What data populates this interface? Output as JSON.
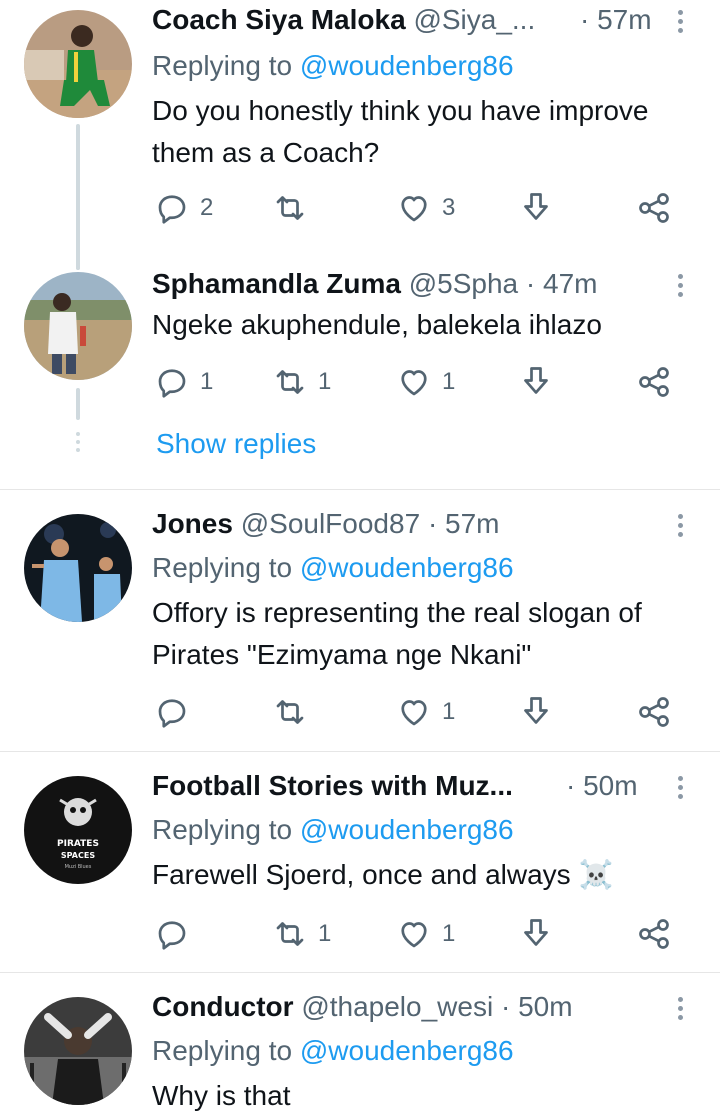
{
  "tweets": [
    {
      "name": "Coach Siya Maloka",
      "handle": "@Siya_...",
      "time": "· 57m",
      "replying_prefix": "Replying to",
      "replying_to": "@woudenberg86",
      "text": "Do you honestly think you have improve them as a Coach?",
      "replies": "2",
      "retweets": "",
      "likes": "3"
    },
    {
      "name": "Sphamandla Zuma",
      "handle": "@5Spha",
      "time": "· 47m",
      "text": "Ngeke akuphendule, balekela ihlazo",
      "replies": "1",
      "retweets": "1",
      "likes": "1",
      "show_replies": "Show replies"
    },
    {
      "name": "Jones",
      "handle": "@SoulFood87",
      "time": "· 57m",
      "replying_prefix": "Replying to",
      "replying_to": "@woudenberg86",
      "text": "Offory is representing the real slogan of Pirates \"Ezimyama nge Nkani\"",
      "replies": "",
      "retweets": "",
      "likes": "1"
    },
    {
      "name": "Football Stories with Muz...",
      "handle": "",
      "time": "· 50m",
      "replying_prefix": "Replying to",
      "replying_to": "@woudenberg86",
      "text": "Farewell Sjoerd, once and always ☠️",
      "replies": "",
      "retweets": "1",
      "likes": "1",
      "avatar_text_1": "PIRATES",
      "avatar_text_2": "SPACES",
      "avatar_text_3": "Muzi Blues"
    },
    {
      "name": "Conductor",
      "handle": "@thapelo_wesi",
      "time": "· 50m",
      "replying_prefix": "Replying to",
      "replying_to": "@woudenberg86",
      "text": "Why is that"
    }
  ],
  "icons": {
    "reply": "reply-icon",
    "retweet": "retweet-icon",
    "like": "like-icon",
    "bookmark": "bookmark-icon",
    "share": "share-icon",
    "more": "more-options-icon"
  },
  "colors": {
    "link": "#1d9bf0",
    "secondary": "#536471",
    "thread_line": "#cfd9de"
  }
}
